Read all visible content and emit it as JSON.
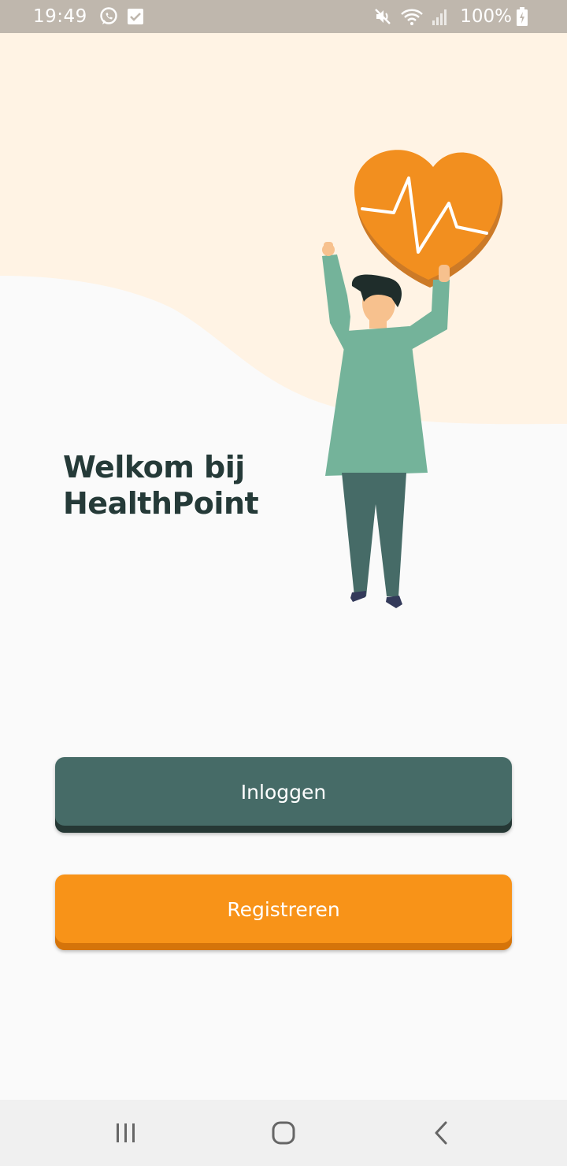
{
  "status_bar": {
    "time": "19:49",
    "left_icons": [
      "whatsapp-icon",
      "checkbox-notification-icon"
    ],
    "right_icons": [
      "mute-icon",
      "wifi-icon",
      "signal-icon",
      "battery-charging-icon"
    ],
    "battery": "100%"
  },
  "welcome": {
    "line1": "Welkom bij",
    "line2": "HealthPoint"
  },
  "buttons": {
    "login_label": "Inloggen",
    "register_label": "Registreren"
  },
  "nav_bar": {
    "icons": [
      "recent-apps-icon",
      "home-icon",
      "back-icon"
    ]
  },
  "colors": {
    "header_bg": "#fff3e4",
    "title": "#253a38",
    "login_button": "#466b67",
    "register_button": "#f89318",
    "heart": "#f28f1f",
    "shirt": "#74b39a",
    "pants": "#466b67"
  }
}
